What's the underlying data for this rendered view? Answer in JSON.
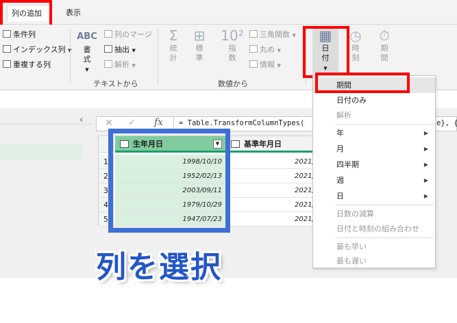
{
  "tabs": {
    "add_column": "列の追加",
    "view": "表示"
  },
  "ribbon": {
    "general": {
      "conditional": "条件列",
      "index": "インデックス列",
      "duplicate": "重複する列"
    },
    "text": {
      "format": "書式",
      "merge": "列のマージ",
      "extract": "抽出",
      "parse": "解析",
      "group_label": "テキストから"
    },
    "number": {
      "stats": "統計",
      "standard": "標準",
      "scientific": "指数",
      "trig": "三角関数",
      "round": "丸め",
      "info": "情報",
      "group_label": "数値から"
    },
    "datetime": {
      "date": "日付",
      "time": "時刻",
      "duration": "期間"
    }
  },
  "formula": {
    "text": "= Table.TransformColumnTypes(",
    "tail": "e}, {"
  },
  "table": {
    "columns": [
      "生年月日",
      "基準年月日"
    ],
    "rows": [
      {
        "n": "1",
        "birth": "1998/10/10",
        "base": "2021/"
      },
      {
        "n": "2",
        "birth": "1952/02/13",
        "base": "2021/"
      },
      {
        "n": "3",
        "birth": "2003/09/11",
        "base": "2021/"
      },
      {
        "n": "4",
        "birth": "1979/10/29",
        "base": "2021/"
      },
      {
        "n": "5",
        "birth": "1947/07/23",
        "base": "2021/"
      }
    ]
  },
  "menu": {
    "items": [
      {
        "label": "期間",
        "enabled": true,
        "submenu": false
      },
      {
        "label": "日付のみ",
        "enabled": true,
        "submenu": false
      },
      {
        "label": "解析",
        "enabled": false,
        "submenu": false
      },
      {
        "label": "年",
        "enabled": true,
        "submenu": true
      },
      {
        "label": "月",
        "enabled": true,
        "submenu": true
      },
      {
        "label": "四半期",
        "enabled": true,
        "submenu": true
      },
      {
        "label": "週",
        "enabled": true,
        "submenu": true
      },
      {
        "label": "日",
        "enabled": true,
        "submenu": true
      },
      {
        "label": "日数の減算",
        "enabled": false,
        "submenu": false
      },
      {
        "label": "日付と時刻の組み合わせ",
        "enabled": false,
        "submenu": false
      },
      {
        "label": "最も早い",
        "enabled": false,
        "submenu": false
      },
      {
        "label": "最も遅い",
        "enabled": false,
        "submenu": false
      }
    ]
  },
  "caption": "列を選択",
  "colors": {
    "highlight_red": "#ff0000",
    "select_blue": "#3e6fd6",
    "column_green": "#80cc9e"
  }
}
